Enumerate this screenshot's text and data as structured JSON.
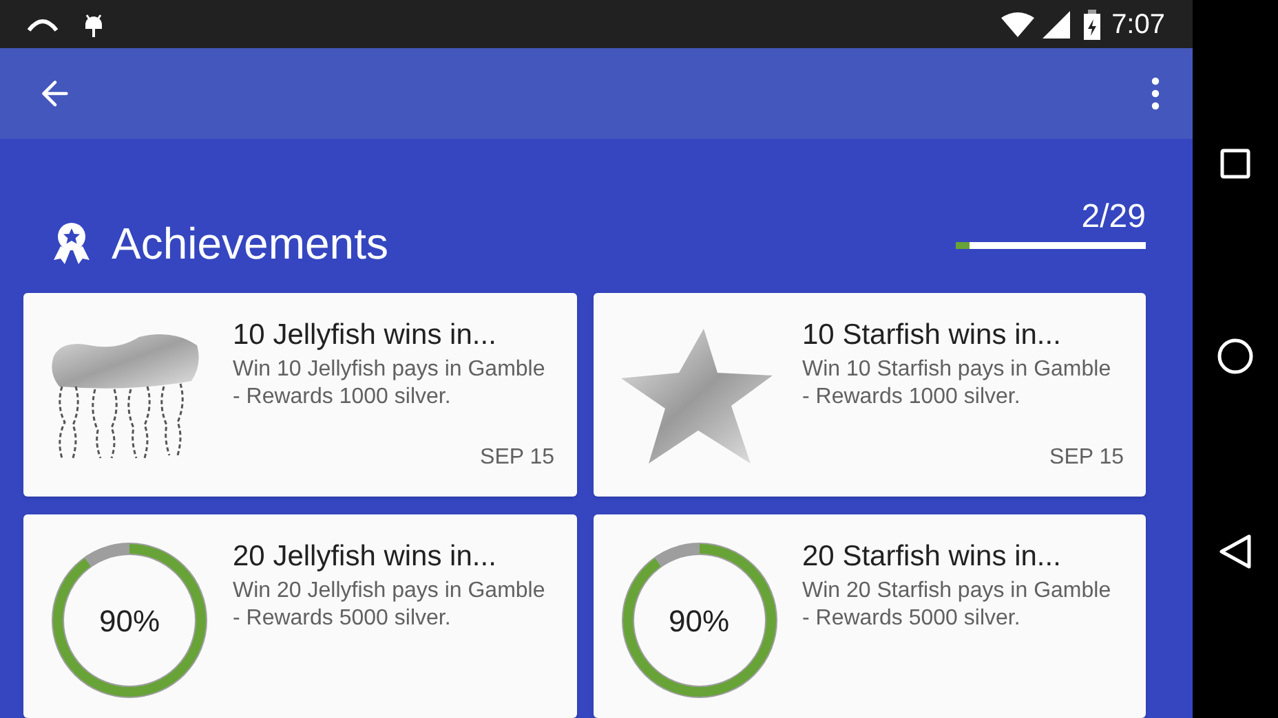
{
  "status_bar": {
    "time": "7:07"
  },
  "header": {
    "title": "Achievements",
    "count": "2/29",
    "level": 0.069
  },
  "achievements": [
    {
      "kind": "jellyfish",
      "title": "10 Jellyfish wins in...",
      "description": "Win 10 Jellyfish pays in Gamble - Rewards 1000 silver.",
      "date": "SEP 15"
    },
    {
      "kind": "starfish",
      "title": "10 Starfish wins in...",
      "description": "Win 10 Starfish pays in Gamble - Rewards 1000 silver.",
      "date": "SEP 15"
    },
    {
      "kind": "progress",
      "title": "20 Jellyfish wins in...",
      "description": "Win 20 Jellyfish pays in Gamble - Rewards 5000 silver.",
      "percent": "90%",
      "level": 0.9
    },
    {
      "kind": "progress",
      "title": "20 Starfish wins in...",
      "description": "Win 20 Starfish pays in Gamble - Rewards 5000 silver.",
      "percent": "90%",
      "level": 0.9
    }
  ]
}
